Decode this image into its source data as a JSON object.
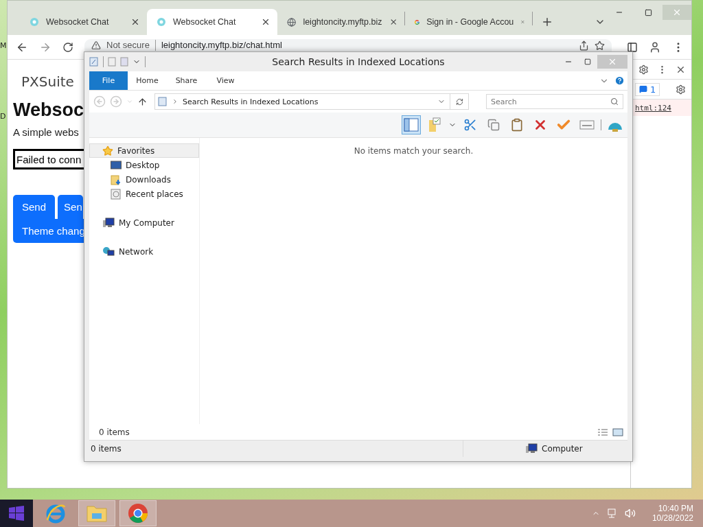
{
  "desktop_labels": [
    "M",
    "D"
  ],
  "browser": {
    "tabs": [
      {
        "title": "Websocket Chat",
        "kind": "chat",
        "selected": false
      },
      {
        "title": "Websocket Chat",
        "kind": "chat",
        "selected": true
      },
      {
        "title": "leightoncity.myftp.biz",
        "kind": "globe",
        "selected": false
      },
      {
        "title": "Sign in - Google Accou",
        "kind": "google",
        "selected": false
      }
    ],
    "address": {
      "security": "Not secure",
      "url": "leightoncity.myftp.biz/chat.html"
    }
  },
  "page": {
    "brand": "PXSuite",
    "heading": "Websoc",
    "subtitle": "A simple webs",
    "message_field": {
      "value": "Failed to conn"
    },
    "buttons": [
      "Send",
      "Sen"
    ],
    "theme_button": "Theme chang"
  },
  "devtools": {
    "message_count": "1",
    "source_link": "html:124"
  },
  "explorer": {
    "title": "Search Results in Indexed Locations",
    "ribbon_tabs": [
      {
        "label": "File",
        "kind": "menu"
      },
      {
        "label": "Home",
        "kind": "tab"
      },
      {
        "label": "Share",
        "kind": "tab"
      },
      {
        "label": "View",
        "kind": "tab"
      }
    ],
    "address": "Search Results in Indexed Locations",
    "search": {
      "placeholder": "Search"
    },
    "toolbar": {
      "layout_pane_on": true
    },
    "nav_pane": [
      {
        "label": "Favorites",
        "kind": "star",
        "selected": true,
        "children": [
          {
            "label": "Desktop",
            "kind": "desktop",
            "selected": false
          },
          {
            "label": "Downloads",
            "kind": "downloads",
            "selected": false
          },
          {
            "label": "Recent places",
            "kind": "recent",
            "selected": false
          }
        ]
      },
      {
        "label": "My Computer",
        "kind": "computer",
        "selected": false
      },
      {
        "label": "Network",
        "kind": "network",
        "selected": false
      }
    ],
    "empty_message": "No items match your search.",
    "item_count": "0 items",
    "status_bar": {
      "items": "0 items",
      "location": "Computer"
    }
  },
  "taskbar": {
    "apps": [
      {
        "kind": "ie",
        "running": false
      },
      {
        "kind": "explorer",
        "running": true
      },
      {
        "kind": "chrome",
        "running": true
      }
    ],
    "clock": {
      "time": "10:40 PM",
      "date": "10/28/2022"
    }
  }
}
